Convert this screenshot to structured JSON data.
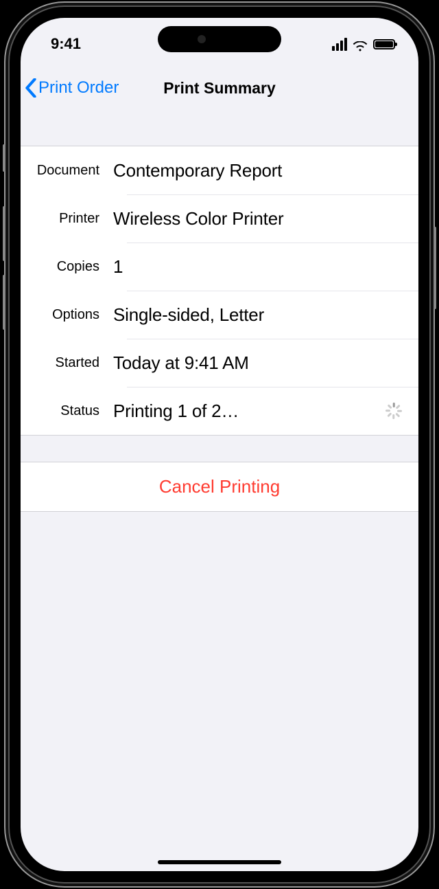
{
  "statusbar": {
    "time": "9:41"
  },
  "navbar": {
    "back_label": "Print Order",
    "title": "Print Summary"
  },
  "labels": {
    "document": "Document",
    "printer": "Printer",
    "copies": "Copies",
    "options": "Options",
    "started": "Started",
    "status": "Status"
  },
  "values": {
    "document": "Contemporary Report",
    "printer": "Wireless Color Printer",
    "copies": "1",
    "options": "Single-sided, Letter",
    "started": "Today at  9:41 AM",
    "status": "Printing 1 of 2…"
  },
  "actions": {
    "cancel": "Cancel Printing"
  }
}
